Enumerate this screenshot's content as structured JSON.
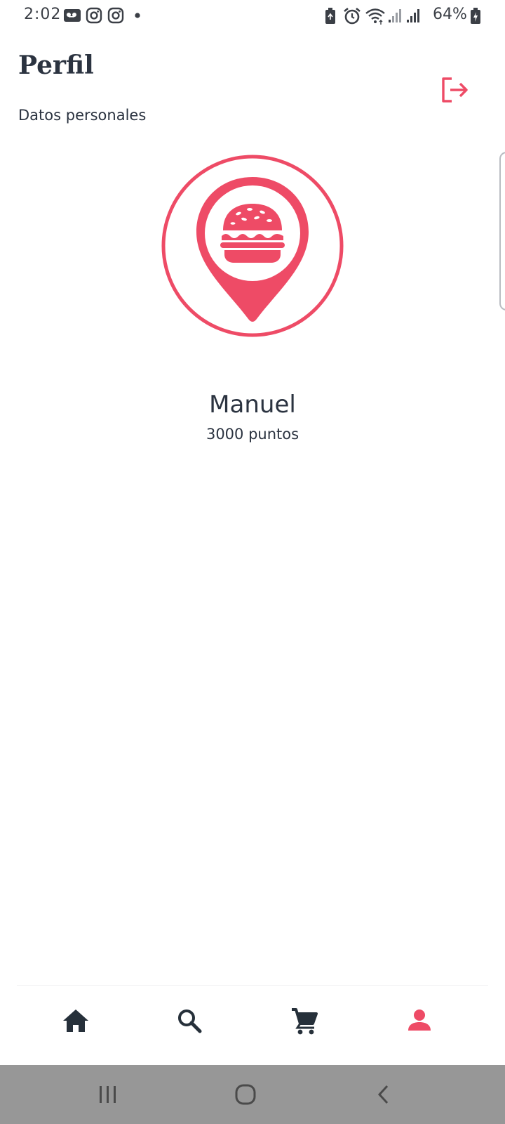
{
  "status_bar": {
    "time": "2:02",
    "battery_percent": "64%",
    "icons": [
      "voicemail-icon",
      "instagram-icon",
      "instagram-icon",
      "notification-dot-icon",
      "battery-saver-icon",
      "alarm-icon",
      "wifi-icon",
      "signal-icon",
      "signal-icon",
      "battery-charging-icon"
    ]
  },
  "header": {
    "title": "Perfil",
    "subtitle": "Datos personales",
    "logout_icon": "logout-icon"
  },
  "profile": {
    "name": "Manuel",
    "points": "3000 puntos",
    "logo_icon": "burger-map-pin-icon"
  },
  "bottom_nav": {
    "items": [
      {
        "icon": "home-icon",
        "active": false
      },
      {
        "icon": "search-icon",
        "active": false
      },
      {
        "icon": "cart-icon",
        "active": false
      },
      {
        "icon": "person-icon",
        "active": true
      }
    ]
  },
  "system_nav": {
    "items": [
      "recent-apps-icon",
      "home-button-icon",
      "back-icon"
    ]
  },
  "colors": {
    "accent": "#ee4b66",
    "text": "#2b3340",
    "icon_dark": "#26303a",
    "system_nav_bg": "#979797"
  }
}
